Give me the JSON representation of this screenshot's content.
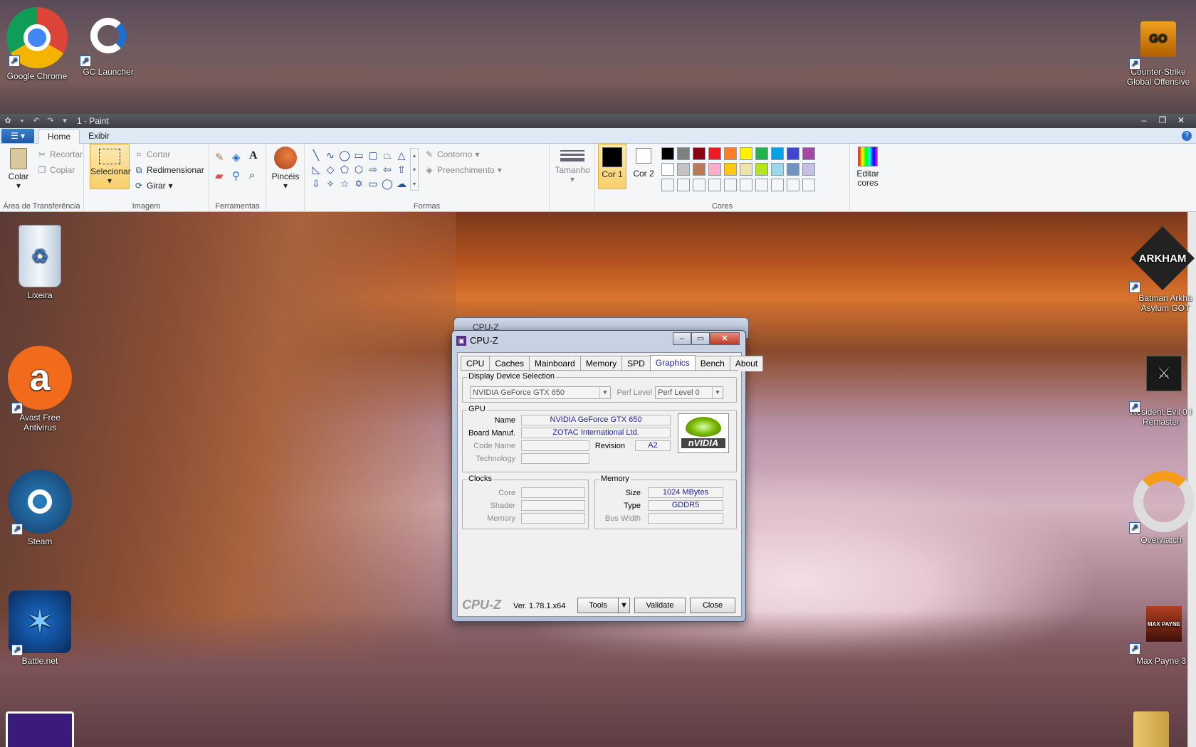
{
  "desktop": {
    "icons_top": [
      {
        "label": "Google Chrome"
      },
      {
        "label": "GC Launcher"
      },
      {
        "label": "Counter-Strike Global Offensive"
      }
    ],
    "icons_left": [
      {
        "label": "Lixeira"
      },
      {
        "label": "Avast Free Antivirus"
      },
      {
        "label": "Steam"
      },
      {
        "label": "Battle.net"
      }
    ],
    "icons_right": [
      {
        "label": "Batman Arkha Asylum GOT"
      },
      {
        "label": "Resident Evil 0 I Remaster"
      },
      {
        "label": "Overwatch"
      },
      {
        "label": "Max Payne 3"
      }
    ],
    "icon_glyphs": {
      "csgo": "GO",
      "arkham": "ARKHAM",
      "max_payne": "MAX PAYNE",
      "avast": "a",
      "battlenet": "✶"
    }
  },
  "paint": {
    "title": "1 - Paint",
    "tabs": [
      "Home",
      "Exibir"
    ],
    "active_tab": "Home",
    "groups": {
      "clipboard": {
        "name": "Área de Transferência",
        "paste": "Colar",
        "cut": "Recortar",
        "copy": "Copiar"
      },
      "image": {
        "name": "Imagem",
        "select": "Selecionar",
        "crop": "Cortar",
        "resize": "Redimensionar",
        "rotate": "Girar"
      },
      "tools": {
        "name": "Ferramentas"
      },
      "brushes": {
        "label": "Pincéis"
      },
      "shapes": {
        "name": "Formas",
        "outline": "Contorno",
        "fill": "Preenchimento"
      },
      "size": {
        "label": "Tamanho"
      },
      "colors": {
        "name": "Cores",
        "color1": "Cor 1",
        "color2": "Cor 2",
        "edit": "Editar cores",
        "palette_row1": [
          "#000000",
          "#7f7f7f",
          "#880015",
          "#ed1c24",
          "#ff7f27",
          "#fff200",
          "#22b14c",
          "#00a2e8",
          "#3f48cc",
          "#a349a4"
        ],
        "palette_row2": [
          "#ffffff",
          "#c3c3c3",
          "#b97a57",
          "#ffaec9",
          "#ffc90e",
          "#efe4b0",
          "#b5e61d",
          "#99d9ea",
          "#7092be",
          "#c8bfe7"
        ]
      }
    }
  },
  "cpuz": {
    "title": "CPU-Z",
    "tabs": [
      "CPU",
      "Caches",
      "Mainboard",
      "Memory",
      "SPD",
      "Graphics",
      "Bench",
      "About"
    ],
    "active_tab": "Graphics",
    "display_selection": {
      "legend": "Display Device Selection",
      "device": "NVIDIA GeForce GTX 650",
      "perf_label": "Perf Level",
      "perf_value": "Perf Level 0"
    },
    "gpu": {
      "legend": "GPU",
      "name_label": "Name",
      "name": "NVIDIA GeForce GTX 650",
      "board_label": "Board Manuf.",
      "board": "ZOTAC International Ltd.",
      "code_label": "Code Name",
      "code": "",
      "revision_label": "Revision",
      "revision": "A2",
      "tech_label": "Technology",
      "tech": "",
      "vendor_logo": "nVIDIA"
    },
    "clocks": {
      "legend": "Clocks",
      "core_label": "Core",
      "shader_label": "Shader",
      "memory_label": "Memory"
    },
    "memory": {
      "legend": "Memory",
      "size_label": "Size",
      "size": "1024 MBytes",
      "type_label": "Type",
      "type": "GDDR5",
      "bus_label": "Bus Width",
      "bus": ""
    },
    "footer": {
      "logo": "CPU-Z",
      "version": "Ver. 1.78.1.x64",
      "tools": "Tools",
      "validate": "Validate",
      "close": "Close"
    }
  }
}
